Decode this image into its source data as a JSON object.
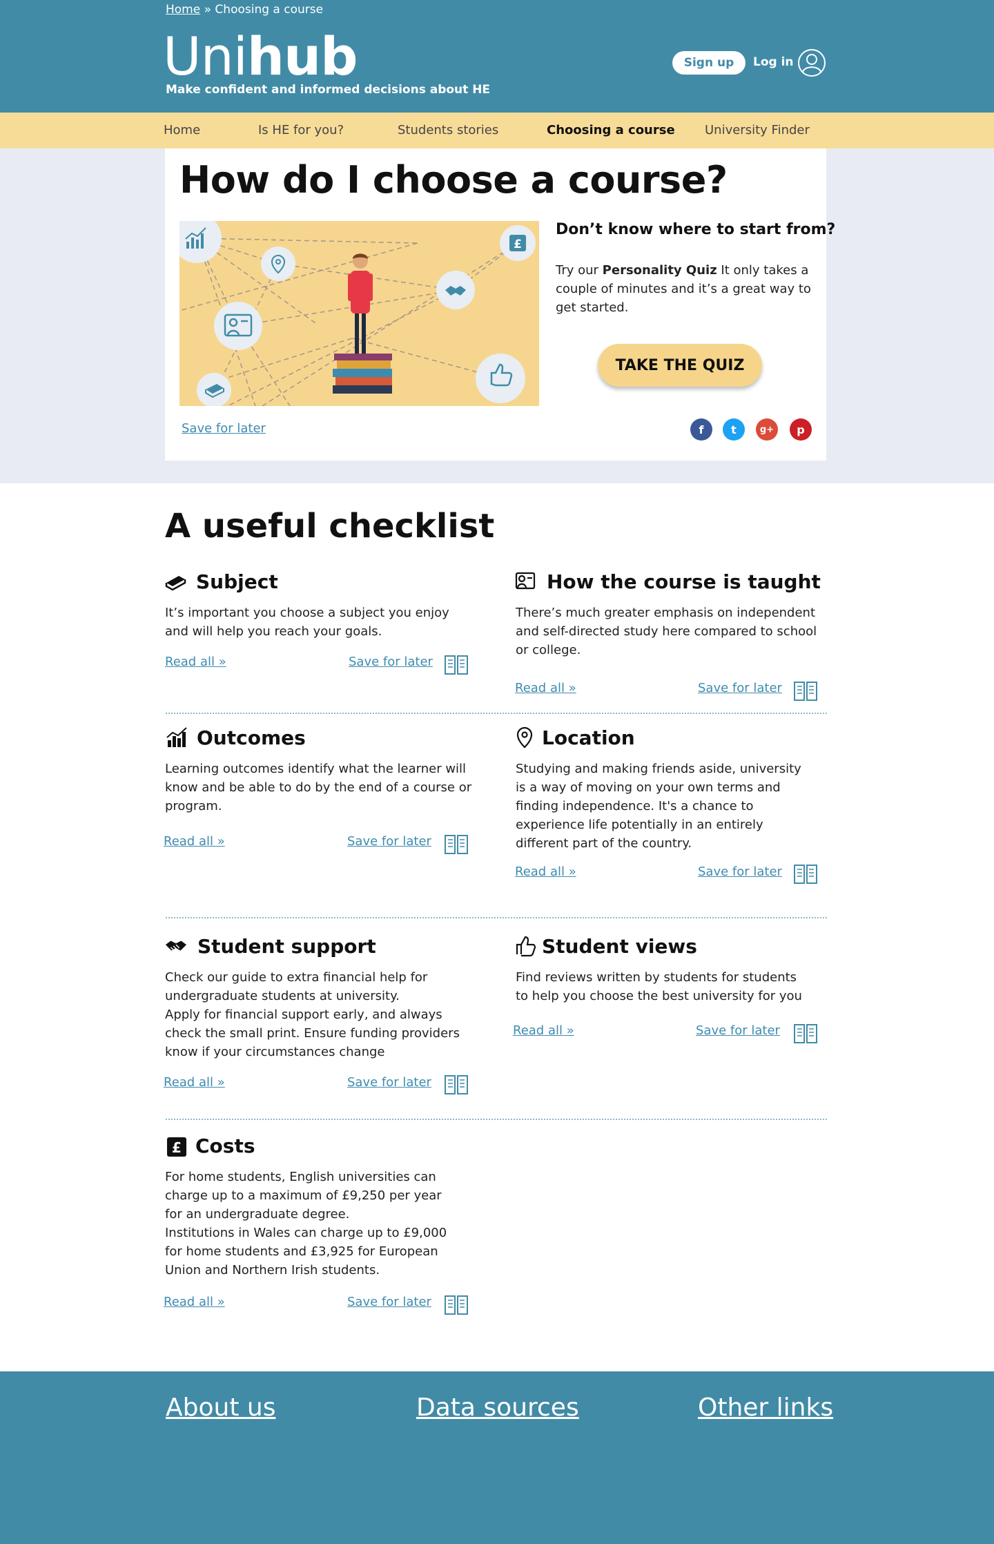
{
  "header": {
    "breadcrumb_home": "Home",
    "breadcrumb_sep": " » ",
    "breadcrumb_current": "Choosing a course",
    "logo_light": "Uni",
    "logo_bold": "hub",
    "tagline": "Make confident and informed decisions about HE",
    "signup_label": "Sign up",
    "login_label": "Log in"
  },
  "nav": {
    "items": [
      {
        "label": "Home"
      },
      {
        "label": "Is HE for you?"
      },
      {
        "label": "Students stories"
      },
      {
        "label": "Choosing a course"
      },
      {
        "label": "University Finder"
      }
    ],
    "active": "Choosing a course"
  },
  "hero": {
    "title": "How do I choose a course?",
    "subtitle": "Don’t know where to start from?",
    "text_pre": "Try our ",
    "text_bold": "Personality Quiz",
    "text_post": " It only takes a couple of minutes and it’s a great way to get started.",
    "quiz_button": "TAKE THE QUIZ",
    "save_label": "Save for later",
    "social": [
      {
        "name": "facebook",
        "glyph": "f",
        "color": "#3b5998"
      },
      {
        "name": "twitter",
        "glyph": "t",
        "color": "#1da1f2"
      },
      {
        "name": "google-plus",
        "glyph": "g+",
        "color": "#dd4b39"
      },
      {
        "name": "pinterest",
        "glyph": "p",
        "color": "#cb2027"
      }
    ]
  },
  "checklist": {
    "title": "A useful checklist",
    "read_label": "Read all »",
    "save_label": "Save for later",
    "items": [
      {
        "title": "Subject",
        "icon": "book-icon",
        "desc": "It’s important you choose a subject you enjoy and will help you reach your goals."
      },
      {
        "title": "How the course is taught",
        "icon": "presentation-icon",
        "desc": "There’s much greater emphasis on independent and self-directed study here compared to school or college."
      },
      {
        "title": "Outcomes",
        "icon": "chart-icon",
        "desc": "Learning outcomes identify what the learner will know and be able to do by the end of a course or program."
      },
      {
        "title": "Location",
        "icon": "location-pin-icon",
        "desc": "Studying and making friends aside, university is a way of moving on your own terms and finding independence. It's a chance to experience life potentially in an entirely different part of the country."
      },
      {
        "title": "Student support",
        "icon": "handshake-icon",
        "desc": "Check our guide to extra financial help for undergraduate students at university.\nApply for financial support early, and always check the small print. Ensure funding providers know if your circumstances change"
      },
      {
        "title": "Student views",
        "icon": "thumbs-up-icon",
        "desc": "Find reviews written by students for students to help you choose the best university for you"
      },
      {
        "title": "Costs",
        "icon": "pound-icon",
        "desc": "For home students, English universities can charge up to a maximum of £9,250 per year for an undergraduate degree.\nInstitutions in Wales can charge up to £9,000 for home students and £3,925 for European Union and Northern Irish students."
      }
    ]
  },
  "footer": {
    "links": [
      {
        "label": "About us"
      },
      {
        "label": "Data sources"
      },
      {
        "label": "Other links"
      }
    ]
  },
  "colors": {
    "header_bg": "#418ba7",
    "nav_bg": "#f7dc98",
    "hero_bg": "#e9ebf4",
    "link": "#3d8bb0",
    "quiz_button": "#f6d58b"
  }
}
